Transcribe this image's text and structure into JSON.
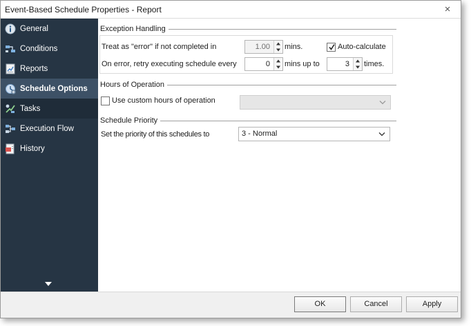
{
  "window": {
    "title": "Event-Based Schedule Properties - Report",
    "close_glyph": "×"
  },
  "sidebar": {
    "items": [
      {
        "label": "General",
        "icon": "info-icon"
      },
      {
        "label": "Conditions",
        "icon": "conditions-icon"
      },
      {
        "label": "Reports",
        "icon": "report-icon"
      },
      {
        "label": "Schedule Options",
        "icon": "schedule-options-icon",
        "active": true
      },
      {
        "label": "Tasks",
        "icon": "tasks-icon"
      },
      {
        "label": "Execution Flow",
        "icon": "execution-flow-icon"
      },
      {
        "label": "History",
        "icon": "history-icon"
      }
    ]
  },
  "exception_handling": {
    "title": "Exception Handling",
    "error_label": "Treat as \"error\" if not completed in",
    "error_value": "1.00",
    "error_unit": "mins.",
    "auto_calculate_label": "Auto-calculate",
    "auto_calculate_checked": true,
    "retry_label": "On error, retry  executing schedule every",
    "retry_every_value": "0",
    "retry_every_unit": "mins up to",
    "retry_times_value": "3",
    "retry_times_unit": "times."
  },
  "hours_of_operation": {
    "title": "Hours of Operation",
    "custom_label": "Use custom hours of operation",
    "custom_checked": false,
    "selected": ""
  },
  "schedule_priority": {
    "title": "Schedule Priority",
    "label": "Set the priority of this schedules to",
    "selected": "3 - Normal"
  },
  "footer": {
    "ok_label": "OK",
    "cancel_label": "Cancel",
    "apply_label": "Apply"
  },
  "colors": {
    "sidebar_bg": "#263544",
    "sidebar_active": "#3d5166"
  }
}
